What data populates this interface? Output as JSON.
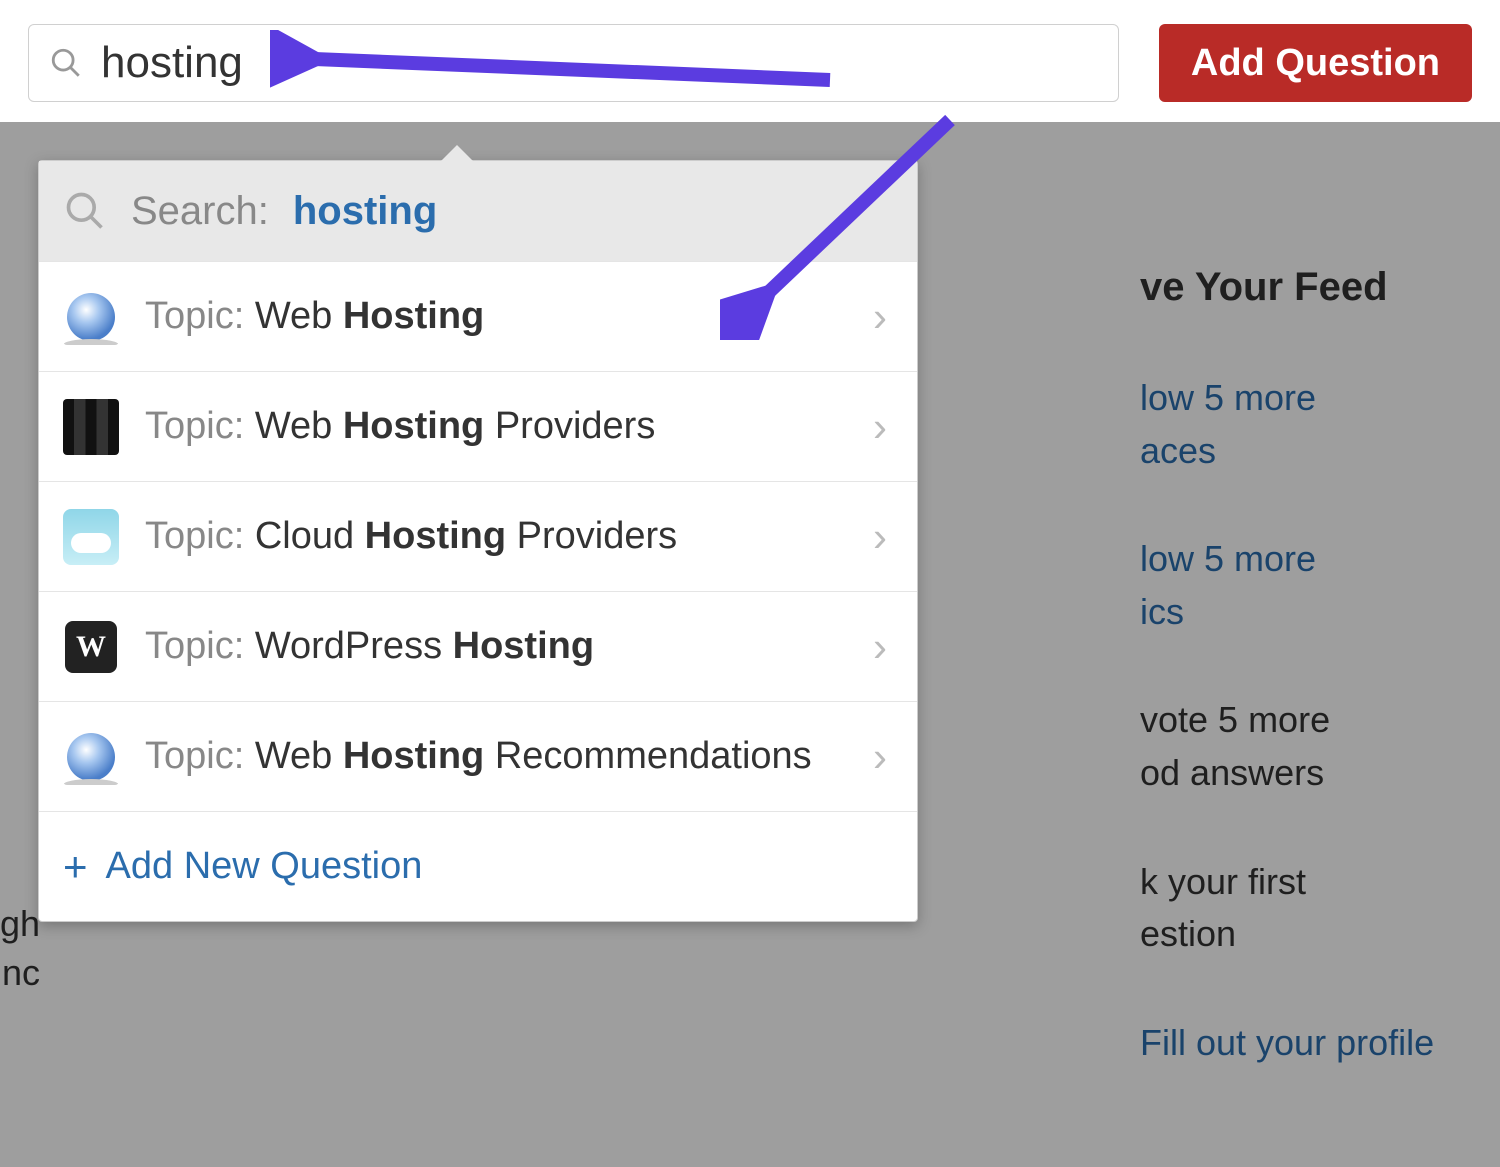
{
  "top": {
    "search_value": "hosting",
    "add_question_label": "Add Question"
  },
  "dropdown": {
    "search_prefix": "Search:",
    "search_term": "hosting",
    "items": [
      {
        "prefix": "Topic:",
        "pre": "Web ",
        "match": "Hosting",
        "post": ""
      },
      {
        "prefix": "Topic:",
        "pre": "Web ",
        "match": "Hosting",
        "post": " Providers"
      },
      {
        "prefix": "Topic:",
        "pre": "Cloud ",
        "match": "Hosting",
        "post": " Providers"
      },
      {
        "prefix": "Topic:",
        "pre": "WordPress ",
        "match": "Hosting",
        "post": ""
      },
      {
        "prefix": "Topic:",
        "pre": "Web ",
        "match": "Hosting",
        "post": " Recommendations"
      }
    ],
    "footer_label": "Add New Question"
  },
  "bg_sidebar": {
    "title": "ve Your Feed",
    "row1a": "low 5 more",
    "row1b": "aces",
    "row2a": "low 5 more",
    "row2b": "ics",
    "row3a": "vote 5 more",
    "row3b": "od answers",
    "row4a": "k your first",
    "row4b": "estion",
    "row5": "Fill out your profile"
  },
  "bg_left": {
    "l1": "gh",
    "l2": "nc"
  },
  "annotation": {
    "arrow_color": "#5b3ce0"
  }
}
